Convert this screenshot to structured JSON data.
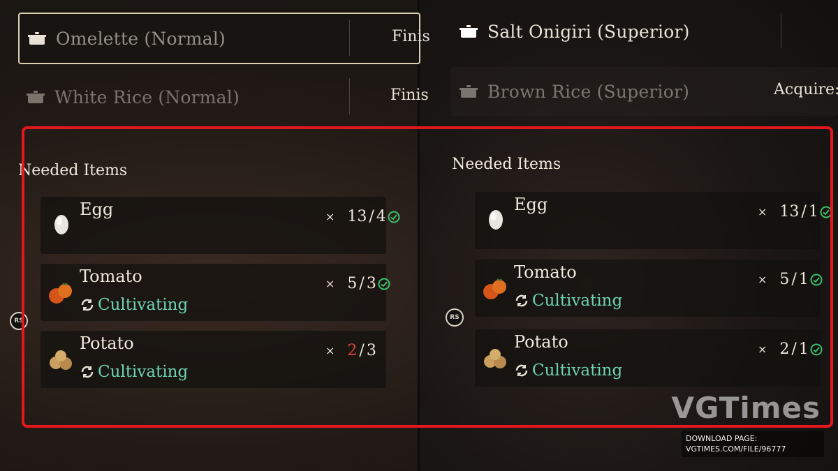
{
  "left": {
    "recipes": [
      {
        "name": "Omelette (Normal)",
        "status": "Finis"
      },
      {
        "name": "White Rice (Normal)",
        "status": "Finis"
      }
    ],
    "heading": "Needed Items",
    "items": [
      {
        "name": "Egg",
        "have": "13",
        "need": "4",
        "cult": ""
      },
      {
        "name": "Tomato",
        "have": "5",
        "need": "3",
        "cult": "Cultivating"
      },
      {
        "name": "Potato",
        "have": "2",
        "need": "3",
        "cult": "Cultivating"
      }
    ]
  },
  "right": {
    "recipes": [
      {
        "name": "Salt Onigiri (Superior)",
        "status": ""
      },
      {
        "name": "Brown Rice (Superior)",
        "status": "Acquire: R"
      }
    ],
    "heading": "Needed Items",
    "items": [
      {
        "name": "Egg",
        "have": "13",
        "need": "1",
        "cult": ""
      },
      {
        "name": "Tomato",
        "have": "5",
        "need": "1",
        "cult": "Cultivating"
      },
      {
        "name": "Potato",
        "have": "2",
        "need": "1",
        "cult": "Cultivating"
      }
    ]
  },
  "qty_prefix": "×",
  "qty_sep": "/",
  "rs_label": "RS",
  "colors": {
    "highlight": "#e4171c",
    "cultivating": "#6fd4b4",
    "shortage": "#e0443a",
    "check": "#3fbf6a"
  },
  "watermark": {
    "brand": "VGTimes",
    "line1": "DOWNLOAD PAGE:",
    "line2": "VGTIMES.COM/FILE/96777"
  }
}
